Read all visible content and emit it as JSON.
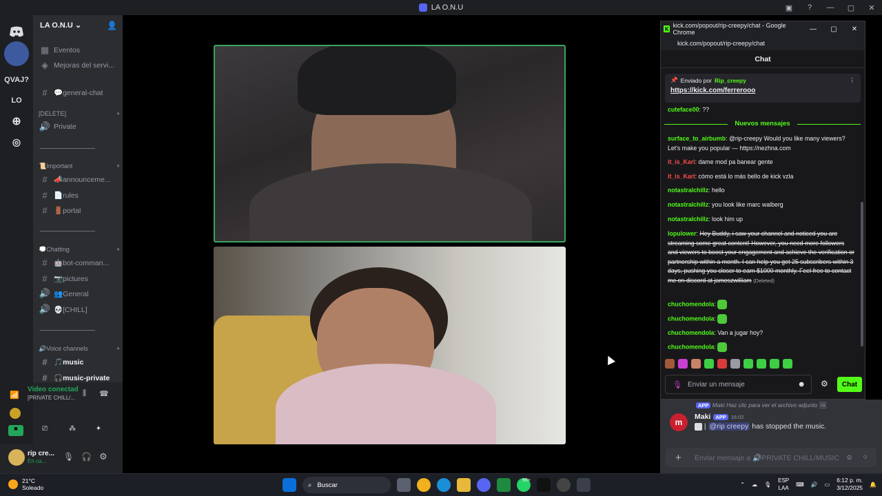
{
  "window": {
    "title": "LA O.N.U"
  },
  "server_rail": {
    "items": [
      "QVAJ?",
      "LO"
    ]
  },
  "sidebar": {
    "server_name": "LA O.N.U",
    "top_items": [
      "Eventos",
      "Mejoras del servi..."
    ],
    "channels": [
      {
        "icon": "#",
        "label": "💬general-chat"
      },
      {
        "cat": "[DELETE]"
      },
      {
        "icon": "🔊",
        "label": "Private"
      },
      {
        "cat": "📜Important"
      },
      {
        "icon": "#",
        "label": "📣announceme..."
      },
      {
        "icon": "#",
        "label": "📄rules"
      },
      {
        "icon": "#",
        "label": "🚪portal"
      },
      {
        "cat": "💭Chatting"
      },
      {
        "icon": "#",
        "label": "🤖bot-comman..."
      },
      {
        "icon": "#",
        "label": "📷pictures"
      },
      {
        "icon": "🔊",
        "label": "👥General"
      },
      {
        "icon": "🔊",
        "label": "💀[CHILL]"
      },
      {
        "cat": "🔊Voice channels"
      },
      {
        "icon": "#",
        "label": "🎵music"
      },
      {
        "icon": "#",
        "label": "🎧music-private"
      }
    ],
    "voice_status": "Video conectad",
    "voice_channel": "[PRIVATE CHILL/...",
    "user_name": "rip cre...",
    "user_status": "En ca..."
  },
  "chrome": {
    "title": "kick.com/popout/rip-creepy/chat - Google Chrome",
    "url": "kick.com/popout/rip-creepy/chat",
    "chat_header": "Chat",
    "pinned_sent_by": "Enviado por",
    "pinned_user": "Rip_creepy",
    "pinned_link": "https://kick.com/ferrerooo",
    "new_messages_label": "Nuevos mensajes",
    "messages": [
      {
        "user": "cuteface00",
        "color": "g",
        "text": "??"
      },
      {
        "user": "surface_to_airbumb",
        "color": "g",
        "text": "@rip-creepy Would you like many viewers? Let's make you popular — https://nezhna.com"
      },
      {
        "user": "it_is_Karl",
        "color": "r",
        "text": "dame mod pa banear gente"
      },
      {
        "user": "it_is_Karl",
        "color": "r",
        "text": "cómo está lo más bello de kick vzla"
      },
      {
        "user": "notastralchillz",
        "color": "g",
        "text": "hello"
      },
      {
        "user": "notastralchillz",
        "color": "g",
        "text": "you look like marc walberg"
      },
      {
        "user": "notastralchillz",
        "color": "g",
        "text": "look him up"
      },
      {
        "user": "lopulower",
        "color": "g",
        "text": "Hey Buddy, i saw your channel and noticed you are streaming some great content! However, you need more followers and viewers to boost your engagement and achieve the verification or partnership within a month. I can help you get 25 subscribers within 3 days, pushing you closer to earn $1000 monthly. Feel free to contact me on discord at jameszwilliam",
        "deleted": "(Deleted)"
      },
      {
        "user": "chuchomendola",
        "color": "g",
        "text": ""
      },
      {
        "user": "chuchomendola",
        "color": "g",
        "text": ""
      },
      {
        "user": "chuchomendola",
        "color": "g",
        "text": "Van a jugar hoy?"
      },
      {
        "user": "chuchomendola",
        "color": "g",
        "text": ""
      }
    ],
    "input_placeholder": "Enviar un mensaje",
    "send_label": "Chat"
  },
  "discord_text": {
    "reply_app": "APP",
    "reply_text": "Maki Haz clic para ver el archivo adjunto",
    "author": "Maki",
    "app_badge": "APP",
    "time": "16:02",
    "mention": "@rip creepy",
    "content": "has stopped the music.",
    "composer_placeholder": "Enviar mensaje a 🔊PRIVATE CHILL/MUSIC"
  },
  "taskbar": {
    "temp": "21°C",
    "weather": "Soleado",
    "search": "Buscar",
    "badge": "99+",
    "lang1": "ESP",
    "lang2": "LAA",
    "time": "6:12 p. m.",
    "date": "3/12/2025"
  }
}
